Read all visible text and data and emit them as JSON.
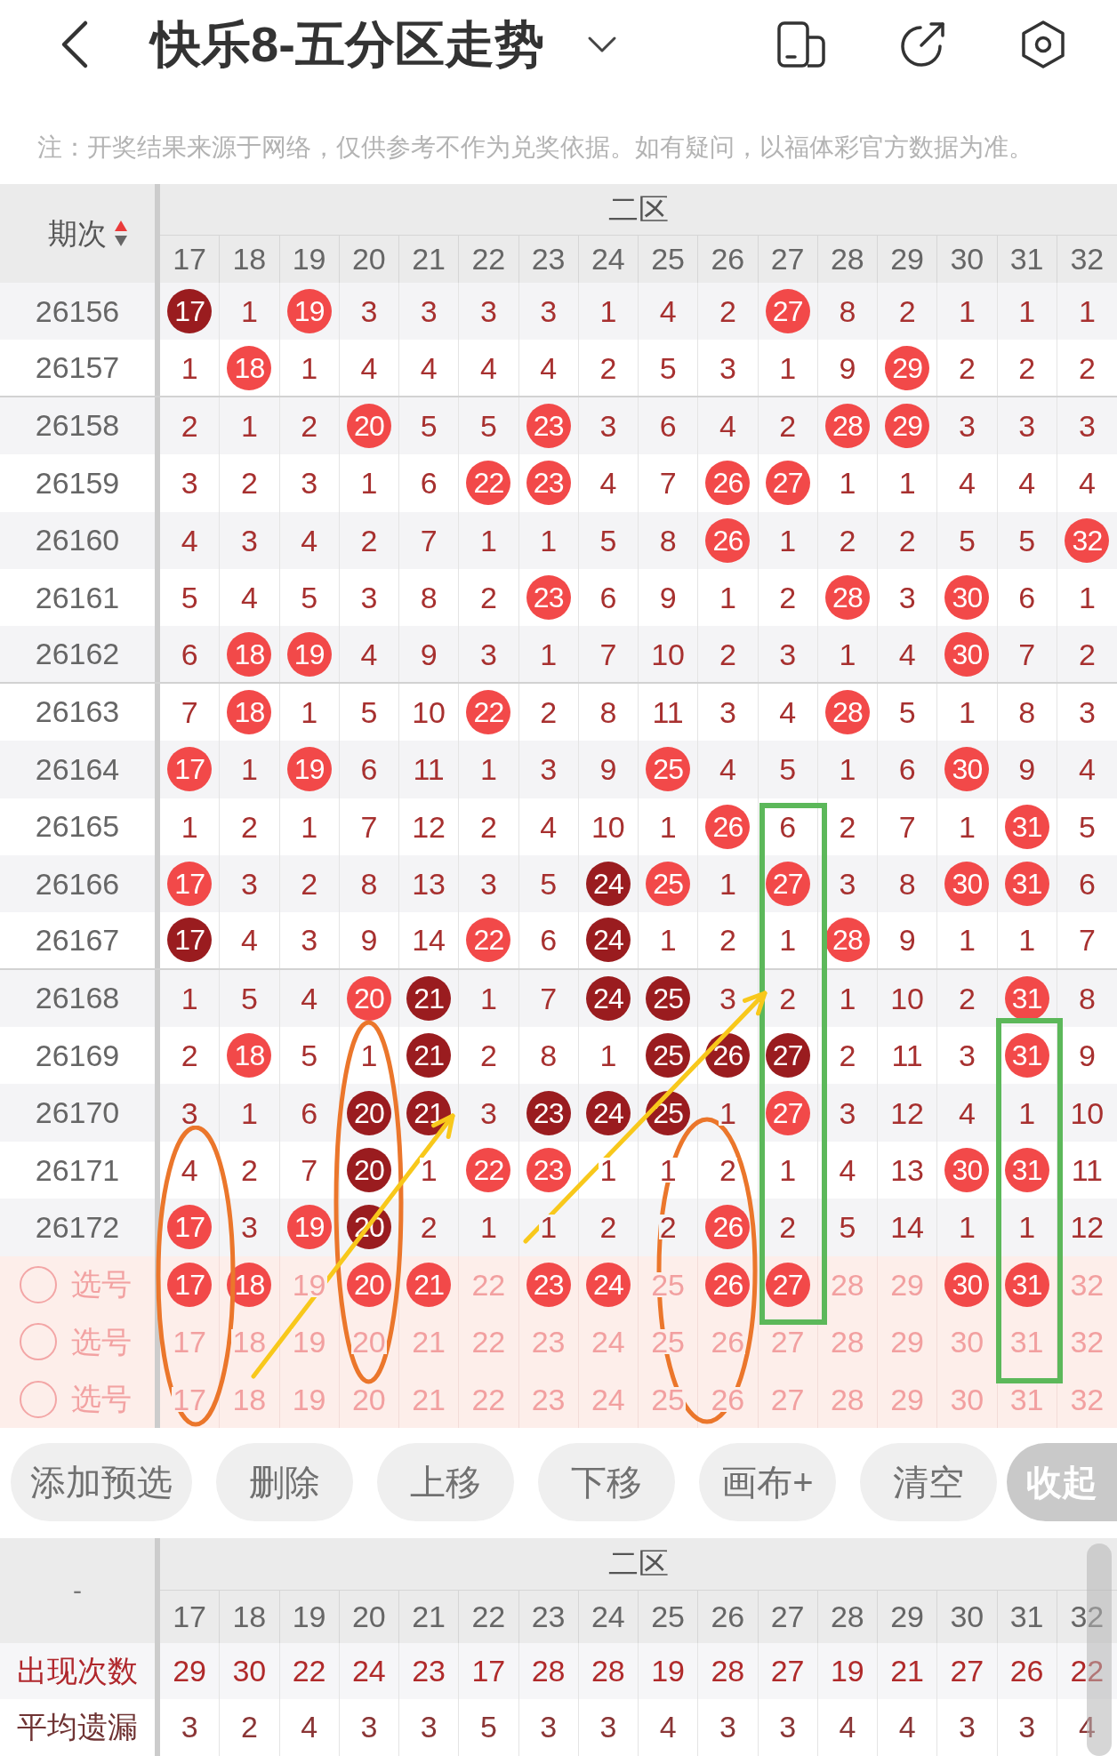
{
  "header": {
    "title": "快乐8-五分区走势"
  },
  "notice": "注：开奖结果来源于网络，仅供参考不作为兑奖依据。如有疑问，以福体彩官方数据为准。",
  "trend_table": {
    "period_header": "期次",
    "sort_ascending": true,
    "zone": "二区",
    "columns": [
      "17",
      "18",
      "19",
      "20",
      "21",
      "22",
      "23",
      "24",
      "25",
      "26",
      "27",
      "28",
      "29",
      "30",
      "31",
      "32"
    ],
    "rows": [
      {
        "period": "26156",
        "cells": [
          {
            "value": "17",
            "kind": "dark"
          },
          {
            "value": "1",
            "kind": "miss"
          },
          {
            "value": "19",
            "kind": "hit"
          },
          {
            "value": "3",
            "kind": "miss"
          },
          {
            "value": "3",
            "kind": "miss"
          },
          {
            "value": "3",
            "kind": "miss"
          },
          {
            "value": "3",
            "kind": "miss"
          },
          {
            "value": "1",
            "kind": "miss"
          },
          {
            "value": "4",
            "kind": "miss"
          },
          {
            "value": "2",
            "kind": "miss"
          },
          {
            "value": "27",
            "kind": "hit"
          },
          {
            "value": "8",
            "kind": "miss"
          },
          {
            "value": "2",
            "kind": "miss"
          },
          {
            "value": "1",
            "kind": "miss"
          },
          {
            "value": "1",
            "kind": "miss"
          },
          {
            "value": "1",
            "kind": "miss"
          }
        ]
      },
      {
        "period": "26157",
        "cells": [
          {
            "value": "1",
            "kind": "miss"
          },
          {
            "value": "18",
            "kind": "hit"
          },
          {
            "value": "1",
            "kind": "miss"
          },
          {
            "value": "4",
            "kind": "miss"
          },
          {
            "value": "4",
            "kind": "miss"
          },
          {
            "value": "4",
            "kind": "miss"
          },
          {
            "value": "4",
            "kind": "miss"
          },
          {
            "value": "2",
            "kind": "miss"
          },
          {
            "value": "5",
            "kind": "miss"
          },
          {
            "value": "3",
            "kind": "miss"
          },
          {
            "value": "1",
            "kind": "miss"
          },
          {
            "value": "9",
            "kind": "miss"
          },
          {
            "value": "29",
            "kind": "hit"
          },
          {
            "value": "2",
            "kind": "miss"
          },
          {
            "value": "2",
            "kind": "miss"
          },
          {
            "value": "2",
            "kind": "miss"
          }
        ]
      },
      {
        "period": "26158",
        "cells": [
          {
            "value": "2",
            "kind": "miss"
          },
          {
            "value": "1",
            "kind": "miss"
          },
          {
            "value": "2",
            "kind": "miss"
          },
          {
            "value": "20",
            "kind": "hit"
          },
          {
            "value": "5",
            "kind": "miss"
          },
          {
            "value": "5",
            "kind": "miss"
          },
          {
            "value": "23",
            "kind": "hit"
          },
          {
            "value": "3",
            "kind": "miss"
          },
          {
            "value": "6",
            "kind": "miss"
          },
          {
            "value": "4",
            "kind": "miss"
          },
          {
            "value": "2",
            "kind": "miss"
          },
          {
            "value": "28",
            "kind": "hit"
          },
          {
            "value": "29",
            "kind": "hit"
          },
          {
            "value": "3",
            "kind": "miss"
          },
          {
            "value": "3",
            "kind": "miss"
          },
          {
            "value": "3",
            "kind": "miss"
          }
        ]
      },
      {
        "period": "26159",
        "cells": [
          {
            "value": "3",
            "kind": "miss"
          },
          {
            "value": "2",
            "kind": "miss"
          },
          {
            "value": "3",
            "kind": "miss"
          },
          {
            "value": "1",
            "kind": "miss"
          },
          {
            "value": "6",
            "kind": "miss"
          },
          {
            "value": "22",
            "kind": "hit"
          },
          {
            "value": "23",
            "kind": "hit"
          },
          {
            "value": "4",
            "kind": "miss"
          },
          {
            "value": "7",
            "kind": "miss"
          },
          {
            "value": "26",
            "kind": "hit"
          },
          {
            "value": "27",
            "kind": "hit"
          },
          {
            "value": "1",
            "kind": "miss"
          },
          {
            "value": "1",
            "kind": "miss"
          },
          {
            "value": "4",
            "kind": "miss"
          },
          {
            "value": "4",
            "kind": "miss"
          },
          {
            "value": "4",
            "kind": "miss"
          }
        ]
      },
      {
        "period": "26160",
        "cells": [
          {
            "value": "4",
            "kind": "miss"
          },
          {
            "value": "3",
            "kind": "miss"
          },
          {
            "value": "4",
            "kind": "miss"
          },
          {
            "value": "2",
            "kind": "miss"
          },
          {
            "value": "7",
            "kind": "miss"
          },
          {
            "value": "1",
            "kind": "miss"
          },
          {
            "value": "1",
            "kind": "miss"
          },
          {
            "value": "5",
            "kind": "miss"
          },
          {
            "value": "8",
            "kind": "miss"
          },
          {
            "value": "26",
            "kind": "hit"
          },
          {
            "value": "1",
            "kind": "miss"
          },
          {
            "value": "2",
            "kind": "miss"
          },
          {
            "value": "2",
            "kind": "miss"
          },
          {
            "value": "5",
            "kind": "miss"
          },
          {
            "value": "5",
            "kind": "miss"
          },
          {
            "value": "32",
            "kind": "hit"
          }
        ]
      },
      {
        "period": "26161",
        "cells": [
          {
            "value": "5",
            "kind": "miss"
          },
          {
            "value": "4",
            "kind": "miss"
          },
          {
            "value": "5",
            "kind": "miss"
          },
          {
            "value": "3",
            "kind": "miss"
          },
          {
            "value": "8",
            "kind": "miss"
          },
          {
            "value": "2",
            "kind": "miss"
          },
          {
            "value": "23",
            "kind": "hit"
          },
          {
            "value": "6",
            "kind": "miss"
          },
          {
            "value": "9",
            "kind": "miss"
          },
          {
            "value": "1",
            "kind": "miss"
          },
          {
            "value": "2",
            "kind": "miss"
          },
          {
            "value": "28",
            "kind": "hit"
          },
          {
            "value": "3",
            "kind": "miss"
          },
          {
            "value": "30",
            "kind": "hit"
          },
          {
            "value": "6",
            "kind": "miss"
          },
          {
            "value": "1",
            "kind": "miss"
          }
        ]
      },
      {
        "period": "26162",
        "cells": [
          {
            "value": "6",
            "kind": "miss"
          },
          {
            "value": "18",
            "kind": "hit"
          },
          {
            "value": "19",
            "kind": "hit"
          },
          {
            "value": "4",
            "kind": "miss"
          },
          {
            "value": "9",
            "kind": "miss"
          },
          {
            "value": "3",
            "kind": "miss"
          },
          {
            "value": "1",
            "kind": "miss"
          },
          {
            "value": "7",
            "kind": "miss"
          },
          {
            "value": "10",
            "kind": "miss"
          },
          {
            "value": "2",
            "kind": "miss"
          },
          {
            "value": "3",
            "kind": "miss"
          },
          {
            "value": "1",
            "kind": "miss"
          },
          {
            "value": "4",
            "kind": "miss"
          },
          {
            "value": "30",
            "kind": "hit"
          },
          {
            "value": "7",
            "kind": "miss"
          },
          {
            "value": "2",
            "kind": "miss"
          }
        ]
      },
      {
        "period": "26163",
        "cells": [
          {
            "value": "7",
            "kind": "miss"
          },
          {
            "value": "18",
            "kind": "hit"
          },
          {
            "value": "1",
            "kind": "miss"
          },
          {
            "value": "5",
            "kind": "miss"
          },
          {
            "value": "10",
            "kind": "miss"
          },
          {
            "value": "22",
            "kind": "hit"
          },
          {
            "value": "2",
            "kind": "miss"
          },
          {
            "value": "8",
            "kind": "miss"
          },
          {
            "value": "11",
            "kind": "miss"
          },
          {
            "value": "3",
            "kind": "miss"
          },
          {
            "value": "4",
            "kind": "miss"
          },
          {
            "value": "28",
            "kind": "hit"
          },
          {
            "value": "5",
            "kind": "miss"
          },
          {
            "value": "1",
            "kind": "miss"
          },
          {
            "value": "8",
            "kind": "miss"
          },
          {
            "value": "3",
            "kind": "miss"
          }
        ]
      },
      {
        "period": "26164",
        "cells": [
          {
            "value": "17",
            "kind": "hit"
          },
          {
            "value": "1",
            "kind": "miss"
          },
          {
            "value": "19",
            "kind": "hit"
          },
          {
            "value": "6",
            "kind": "miss"
          },
          {
            "value": "11",
            "kind": "miss"
          },
          {
            "value": "1",
            "kind": "miss"
          },
          {
            "value": "3",
            "kind": "miss"
          },
          {
            "value": "9",
            "kind": "miss"
          },
          {
            "value": "25",
            "kind": "hit"
          },
          {
            "value": "4",
            "kind": "miss"
          },
          {
            "value": "5",
            "kind": "miss"
          },
          {
            "value": "1",
            "kind": "miss"
          },
          {
            "value": "6",
            "kind": "miss"
          },
          {
            "value": "30",
            "kind": "hit"
          },
          {
            "value": "9",
            "kind": "miss"
          },
          {
            "value": "4",
            "kind": "miss"
          }
        ]
      },
      {
        "period": "26165",
        "cells": [
          {
            "value": "1",
            "kind": "miss"
          },
          {
            "value": "2",
            "kind": "miss"
          },
          {
            "value": "1",
            "kind": "miss"
          },
          {
            "value": "7",
            "kind": "miss"
          },
          {
            "value": "12",
            "kind": "miss"
          },
          {
            "value": "2",
            "kind": "miss"
          },
          {
            "value": "4",
            "kind": "miss"
          },
          {
            "value": "10",
            "kind": "miss"
          },
          {
            "value": "1",
            "kind": "miss"
          },
          {
            "value": "26",
            "kind": "hit"
          },
          {
            "value": "6",
            "kind": "miss"
          },
          {
            "value": "2",
            "kind": "miss"
          },
          {
            "value": "7",
            "kind": "miss"
          },
          {
            "value": "1",
            "kind": "miss"
          },
          {
            "value": "31",
            "kind": "hit"
          },
          {
            "value": "5",
            "kind": "miss"
          }
        ]
      },
      {
        "period": "26166",
        "cells": [
          {
            "value": "17",
            "kind": "hit"
          },
          {
            "value": "3",
            "kind": "miss"
          },
          {
            "value": "2",
            "kind": "miss"
          },
          {
            "value": "8",
            "kind": "miss"
          },
          {
            "value": "13",
            "kind": "miss"
          },
          {
            "value": "3",
            "kind": "miss"
          },
          {
            "value": "5",
            "kind": "miss"
          },
          {
            "value": "24",
            "kind": "dark"
          },
          {
            "value": "25",
            "kind": "hit"
          },
          {
            "value": "1",
            "kind": "miss"
          },
          {
            "value": "27",
            "kind": "hit"
          },
          {
            "value": "3",
            "kind": "miss"
          },
          {
            "value": "8",
            "kind": "miss"
          },
          {
            "value": "30",
            "kind": "hit"
          },
          {
            "value": "31",
            "kind": "hit"
          },
          {
            "value": "6",
            "kind": "miss"
          }
        ]
      },
      {
        "period": "26167",
        "cells": [
          {
            "value": "17",
            "kind": "dark"
          },
          {
            "value": "4",
            "kind": "miss"
          },
          {
            "value": "3",
            "kind": "miss"
          },
          {
            "value": "9",
            "kind": "miss"
          },
          {
            "value": "14",
            "kind": "miss"
          },
          {
            "value": "22",
            "kind": "hit"
          },
          {
            "value": "6",
            "kind": "miss"
          },
          {
            "value": "24",
            "kind": "dark"
          },
          {
            "value": "1",
            "kind": "miss"
          },
          {
            "value": "2",
            "kind": "miss"
          },
          {
            "value": "1",
            "kind": "miss"
          },
          {
            "value": "28",
            "kind": "hit"
          },
          {
            "value": "9",
            "kind": "miss"
          },
          {
            "value": "1",
            "kind": "miss"
          },
          {
            "value": "1",
            "kind": "miss"
          },
          {
            "value": "7",
            "kind": "miss"
          }
        ]
      },
      {
        "period": "26168",
        "cells": [
          {
            "value": "1",
            "kind": "miss"
          },
          {
            "value": "5",
            "kind": "miss"
          },
          {
            "value": "4",
            "kind": "miss"
          },
          {
            "value": "20",
            "kind": "hit"
          },
          {
            "value": "21",
            "kind": "dark"
          },
          {
            "value": "1",
            "kind": "miss"
          },
          {
            "value": "7",
            "kind": "miss"
          },
          {
            "value": "24",
            "kind": "dark"
          },
          {
            "value": "25",
            "kind": "dark"
          },
          {
            "value": "3",
            "kind": "miss"
          },
          {
            "value": "2",
            "kind": "miss"
          },
          {
            "value": "1",
            "kind": "miss"
          },
          {
            "value": "10",
            "kind": "miss"
          },
          {
            "value": "2",
            "kind": "miss"
          },
          {
            "value": "31",
            "kind": "hit"
          },
          {
            "value": "8",
            "kind": "miss"
          }
        ]
      },
      {
        "period": "26169",
        "cells": [
          {
            "value": "2",
            "kind": "miss"
          },
          {
            "value": "18",
            "kind": "hit"
          },
          {
            "value": "5",
            "kind": "miss"
          },
          {
            "value": "1",
            "kind": "miss"
          },
          {
            "value": "21",
            "kind": "dark"
          },
          {
            "value": "2",
            "kind": "miss"
          },
          {
            "value": "8",
            "kind": "miss"
          },
          {
            "value": "1",
            "kind": "miss"
          },
          {
            "value": "25",
            "kind": "dark"
          },
          {
            "value": "26",
            "kind": "dark"
          },
          {
            "value": "27",
            "kind": "dark"
          },
          {
            "value": "2",
            "kind": "miss"
          },
          {
            "value": "11",
            "kind": "miss"
          },
          {
            "value": "3",
            "kind": "miss"
          },
          {
            "value": "31",
            "kind": "hit"
          },
          {
            "value": "9",
            "kind": "miss"
          }
        ]
      },
      {
        "period": "26170",
        "cells": [
          {
            "value": "3",
            "kind": "miss"
          },
          {
            "value": "1",
            "kind": "miss"
          },
          {
            "value": "6",
            "kind": "miss"
          },
          {
            "value": "20",
            "kind": "dark"
          },
          {
            "value": "21",
            "kind": "dark"
          },
          {
            "value": "3",
            "kind": "miss"
          },
          {
            "value": "23",
            "kind": "dark"
          },
          {
            "value": "24",
            "kind": "dark"
          },
          {
            "value": "25",
            "kind": "dark"
          },
          {
            "value": "1",
            "kind": "miss"
          },
          {
            "value": "27",
            "kind": "hit"
          },
          {
            "value": "3",
            "kind": "miss"
          },
          {
            "value": "12",
            "kind": "miss"
          },
          {
            "value": "4",
            "kind": "miss"
          },
          {
            "value": "1",
            "kind": "miss"
          },
          {
            "value": "10",
            "kind": "miss"
          }
        ]
      },
      {
        "period": "26171",
        "cells": [
          {
            "value": "4",
            "kind": "miss"
          },
          {
            "value": "2",
            "kind": "miss"
          },
          {
            "value": "7",
            "kind": "miss"
          },
          {
            "value": "20",
            "kind": "dark"
          },
          {
            "value": "1",
            "kind": "miss"
          },
          {
            "value": "22",
            "kind": "hit"
          },
          {
            "value": "23",
            "kind": "hit"
          },
          {
            "value": "1",
            "kind": "miss"
          },
          {
            "value": "1",
            "kind": "miss"
          },
          {
            "value": "2",
            "kind": "miss"
          },
          {
            "value": "1",
            "kind": "miss"
          },
          {
            "value": "4",
            "kind": "miss"
          },
          {
            "value": "13",
            "kind": "miss"
          },
          {
            "value": "30",
            "kind": "hit"
          },
          {
            "value": "31",
            "kind": "hit"
          },
          {
            "value": "11",
            "kind": "miss"
          }
        ]
      },
      {
        "period": "26172",
        "cells": [
          {
            "value": "17",
            "kind": "hit"
          },
          {
            "value": "3",
            "kind": "miss"
          },
          {
            "value": "19",
            "kind": "hit"
          },
          {
            "value": "20",
            "kind": "dark"
          },
          {
            "value": "2",
            "kind": "miss"
          },
          {
            "value": "1",
            "kind": "miss"
          },
          {
            "value": "1",
            "kind": "miss"
          },
          {
            "value": "2",
            "kind": "miss"
          },
          {
            "value": "2",
            "kind": "miss"
          },
          {
            "value": "26",
            "kind": "hit"
          },
          {
            "value": "2",
            "kind": "miss"
          },
          {
            "value": "5",
            "kind": "miss"
          },
          {
            "value": "14",
            "kind": "miss"
          },
          {
            "value": "1",
            "kind": "miss"
          },
          {
            "value": "1",
            "kind": "miss"
          },
          {
            "value": "12",
            "kind": "miss"
          }
        ]
      }
    ],
    "picks": [
      {
        "label": "选号",
        "checked": false,
        "numbers": [
          {
            "value": "17",
            "selected": true
          },
          {
            "value": "18",
            "selected": true
          },
          {
            "value": "19",
            "selected": false
          },
          {
            "value": "20",
            "selected": true
          },
          {
            "value": "21",
            "selected": true
          },
          {
            "value": "22",
            "selected": false
          },
          {
            "value": "23",
            "selected": true
          },
          {
            "value": "24",
            "selected": true
          },
          {
            "value": "25",
            "selected": false
          },
          {
            "value": "26",
            "selected": true
          },
          {
            "value": "27",
            "selected": true
          },
          {
            "value": "28",
            "selected": false
          },
          {
            "value": "29",
            "selected": false
          },
          {
            "value": "30",
            "selected": true
          },
          {
            "value": "31",
            "selected": true
          },
          {
            "value": "32",
            "selected": false
          }
        ]
      },
      {
        "label": "选号",
        "checked": false,
        "numbers": [
          {
            "value": "17",
            "selected": false
          },
          {
            "value": "18",
            "selected": false
          },
          {
            "value": "19",
            "selected": false
          },
          {
            "value": "20",
            "selected": false
          },
          {
            "value": "21",
            "selected": false
          },
          {
            "value": "22",
            "selected": false
          },
          {
            "value": "23",
            "selected": false
          },
          {
            "value": "24",
            "selected": false
          },
          {
            "value": "25",
            "selected": false
          },
          {
            "value": "26",
            "selected": false
          },
          {
            "value": "27",
            "selected": false
          },
          {
            "value": "28",
            "selected": false
          },
          {
            "value": "29",
            "selected": false
          },
          {
            "value": "30",
            "selected": false
          },
          {
            "value": "31",
            "selected": false
          },
          {
            "value": "32",
            "selected": false
          }
        ]
      },
      {
        "label": "选号",
        "checked": false,
        "numbers": [
          {
            "value": "17",
            "selected": false
          },
          {
            "value": "18",
            "selected": false
          },
          {
            "value": "19",
            "selected": false
          },
          {
            "value": "20",
            "selected": false
          },
          {
            "value": "21",
            "selected": false
          },
          {
            "value": "22",
            "selected": false
          },
          {
            "value": "23",
            "selected": false
          },
          {
            "value": "24",
            "selected": false
          },
          {
            "value": "25",
            "selected": false
          },
          {
            "value": "26",
            "selected": false
          },
          {
            "value": "27",
            "selected": false
          },
          {
            "value": "28",
            "selected": false
          },
          {
            "value": "29",
            "selected": false
          },
          {
            "value": "30",
            "selected": false
          },
          {
            "value": "31",
            "selected": false
          },
          {
            "value": "32",
            "selected": false
          }
        ]
      }
    ]
  },
  "toolbar": [
    {
      "label": "添加预选",
      "kind": "action"
    },
    {
      "label": "删除",
      "kind": "action"
    },
    {
      "label": "上移",
      "kind": "action"
    },
    {
      "label": "下移",
      "kind": "action"
    },
    {
      "label": "画布+",
      "kind": "action"
    },
    {
      "label": "清空",
      "kind": "action"
    },
    {
      "label": "收起",
      "kind": "collapse"
    }
  ],
  "stats": {
    "corner": "-",
    "zone": "二区",
    "columns": [
      "17",
      "18",
      "19",
      "20",
      "21",
      "22",
      "23",
      "24",
      "25",
      "26",
      "27",
      "28",
      "29",
      "30",
      "31",
      "32"
    ],
    "rows": [
      {
        "label": "出现次数",
        "kind": "count",
        "values": [
          "29",
          "30",
          "22",
          "24",
          "23",
          "17",
          "28",
          "28",
          "19",
          "28",
          "27",
          "19",
          "21",
          "27",
          "26",
          "22"
        ]
      },
      {
        "label": "平均遗漏",
        "kind": "average",
        "values": [
          "3",
          "2",
          "4",
          "3",
          "3",
          "5",
          "3",
          "3",
          "4",
          "3",
          "3",
          "4",
          "4",
          "3",
          "3",
          "4"
        ]
      }
    ]
  },
  "annotations": [
    {
      "kind": "rectangle",
      "color": "#5cb85a"
    },
    {
      "kind": "arrow",
      "color": "#f8c81b"
    },
    {
      "kind": "rectangle",
      "color": "#5cb85a"
    },
    {
      "kind": "ellipse",
      "color": "#eb762b"
    },
    {
      "kind": "arrow",
      "color": "#f8c81b"
    },
    {
      "kind": "ellipse",
      "color": "#eb762b"
    },
    {
      "kind": "ellipse",
      "color": "#eb762b"
    }
  ]
}
